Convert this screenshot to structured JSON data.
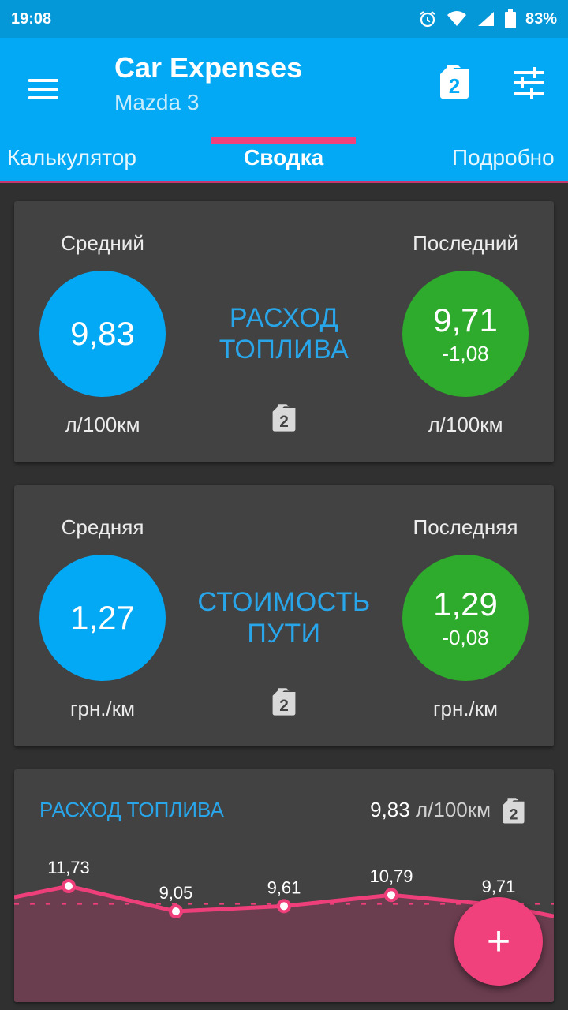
{
  "status_bar": {
    "time": "19:08",
    "battery": "83%"
  },
  "app_bar": {
    "title": "Car Expenses",
    "subtitle": "Mazda 3",
    "fuel_icon_number": "2"
  },
  "tabs": [
    {
      "label": "Калькулятор",
      "active": false
    },
    {
      "label": "Сводка",
      "active": true
    },
    {
      "label": "Подробно",
      "active": false
    }
  ],
  "fuel_card": {
    "left_label": "Средний",
    "right_label": "Последний",
    "average_value": "9,83",
    "last_value": "9,71",
    "last_delta": "-1,08",
    "title_line1": "РАСХОД",
    "title_line2": "ТОПЛИВА",
    "left_unit": "л/100км",
    "right_unit": "л/100км"
  },
  "cost_card": {
    "left_label": "Средняя",
    "right_label": "Последняя",
    "average_value": "1,27",
    "last_value": "1,29",
    "last_delta": "-0,08",
    "title_line1": "СТОИМОСТЬ",
    "title_line2": "ПУТИ",
    "left_unit": "грн./км",
    "right_unit": "грн./км"
  },
  "chart_card": {
    "title": "РАСХОД ТОПЛИВА",
    "average_value": "9,83",
    "average_unit": "л/100км"
  },
  "chart_data": {
    "type": "area",
    "title": "РАСХОД ТОПЛИВА",
    "values": [
      11.73,
      9.05,
      9.61,
      10.79,
      9.71
    ],
    "labels": [
      "11,73",
      "9,05",
      "9,61",
      "10,79",
      "9,71"
    ],
    "average": 9.83,
    "colors": {
      "line": "#ef3f7b",
      "fill": "#6b3e4f",
      "average_line": "#ef3f7b"
    }
  },
  "fab": {
    "label": "+"
  },
  "colors": {
    "primary": "#03a9f4",
    "status_bar": "#0498d8",
    "accent": "#f0417d",
    "green": "#2eaa2c",
    "card": "#424242",
    "background": "#303030"
  },
  "icons": [
    "menu-icon",
    "fuel-can-icon",
    "filter-icon",
    "alarm-icon",
    "wifi-icon",
    "signal-icon",
    "battery-icon",
    "plus-icon"
  ]
}
